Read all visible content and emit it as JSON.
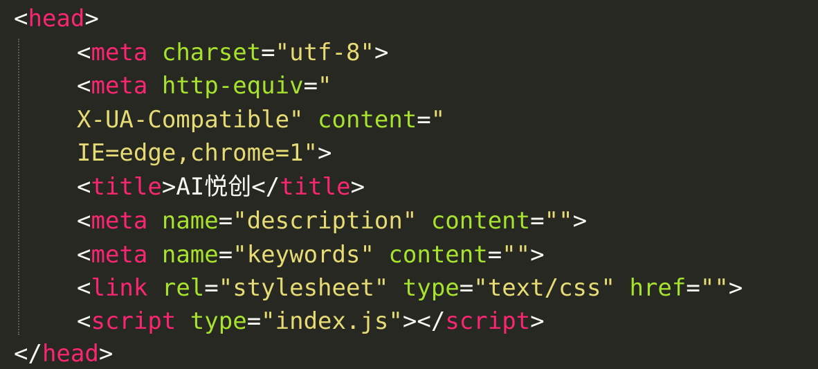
{
  "code": {
    "lines": [
      {
        "open": "<",
        "tag": "head",
        "close": ">"
      },
      {
        "open": "<",
        "tag": "meta",
        "sp": " ",
        "attr": "charset",
        "eq": "=",
        "val": "\"utf-8\"",
        "close": ">"
      },
      {
        "open": "<",
        "tag": "meta",
        "sp": " ",
        "attr": "http-equiv",
        "eq": "=",
        "val": "\""
      },
      {
        "val": "X-UA-Compatible\"",
        "sp": " ",
        "attr": "content",
        "eq": "=",
        "val2": "\""
      },
      {
        "val": "IE=edge,chrome=1\"",
        "close": ">"
      },
      {
        "open": "<",
        "tag": "title",
        "mid": ">",
        "text": "AI悦创",
        "open2": "</",
        "tag2": "title",
        "close": ">"
      },
      {
        "open": "<",
        "tag": "meta",
        "sp": " ",
        "attr": "name",
        "eq": "=",
        "val": "\"description\"",
        "sp2": " ",
        "attr2": "content",
        "eq2": "=",
        "val2": "\"\"",
        "close": ">"
      },
      {
        "open": "<",
        "tag": "meta",
        "sp": " ",
        "attr": "name",
        "eq": "=",
        "val": "\"keywords\"",
        "sp2": " ",
        "attr2": "content",
        "eq2": "=",
        "val2": "\"\"",
        "close": ">"
      },
      {
        "open": "<",
        "tag": "link",
        "sp": " ",
        "attr": "rel",
        "eq": "=",
        "val": "\"stylesheet\"",
        "sp2": " ",
        "attr2": "type",
        "eq2": "=",
        "val2": "\"text/css\"",
        "sp3": " ",
        "attr3": "href",
        "eq3": "=",
        "val3": "\"\"",
        "close": ">"
      },
      {
        "open": "<",
        "tag": "script",
        "sp": " ",
        "attr": "type",
        "eq": "=",
        "val": "\"index.js\"",
        "mid": ">",
        "open2": "</",
        "tag2": "script",
        "close": ">"
      },
      {
        "open": "</",
        "tag": "head",
        "close": ">"
      }
    ]
  },
  "colors": {
    "background": "#272822",
    "tag": "#f92672",
    "attribute": "#a6e22e",
    "string": "#e6db74",
    "punctuation": "#f8f8f2"
  }
}
